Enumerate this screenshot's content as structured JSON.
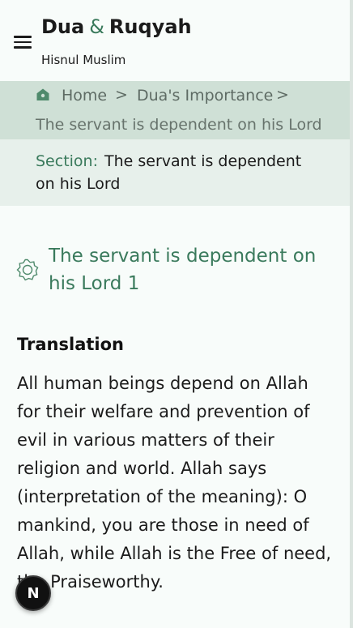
{
  "header": {
    "title_left": "Dua",
    "title_amp": "&",
    "title_right": "Ruqyah",
    "subtitle": "Hisnul Muslim"
  },
  "breadcrumb": {
    "home": "Home",
    "separator": ">",
    "category": "Dua's Importance",
    "current": "The servant is dependent on his Lord"
  },
  "section": {
    "label": "Section:",
    "value": "The servant is dependent on his Lord"
  },
  "dua": {
    "title": "The servant is dependent on his Lord 1",
    "translation_heading": "Translation",
    "translation_text": "All human beings depend on Allah for their welfare and prevention of evil in various matters of their religion and world. Allah says (interpretation of the meaning): O mankind, you are those in need of Allah, while Allah is the Free of need, the Praiseworthy."
  },
  "fab": {
    "letter": "N"
  },
  "colors": {
    "accent": "#3a7a5c",
    "breadcrumb_bg": "#cfe0d6",
    "section_bg": "#e7f0eb",
    "page_bg": "#f8fcfa"
  },
  "icons": {
    "menu": "menu-icon",
    "home": "home-icon",
    "dua": "dua-badge-icon"
  }
}
